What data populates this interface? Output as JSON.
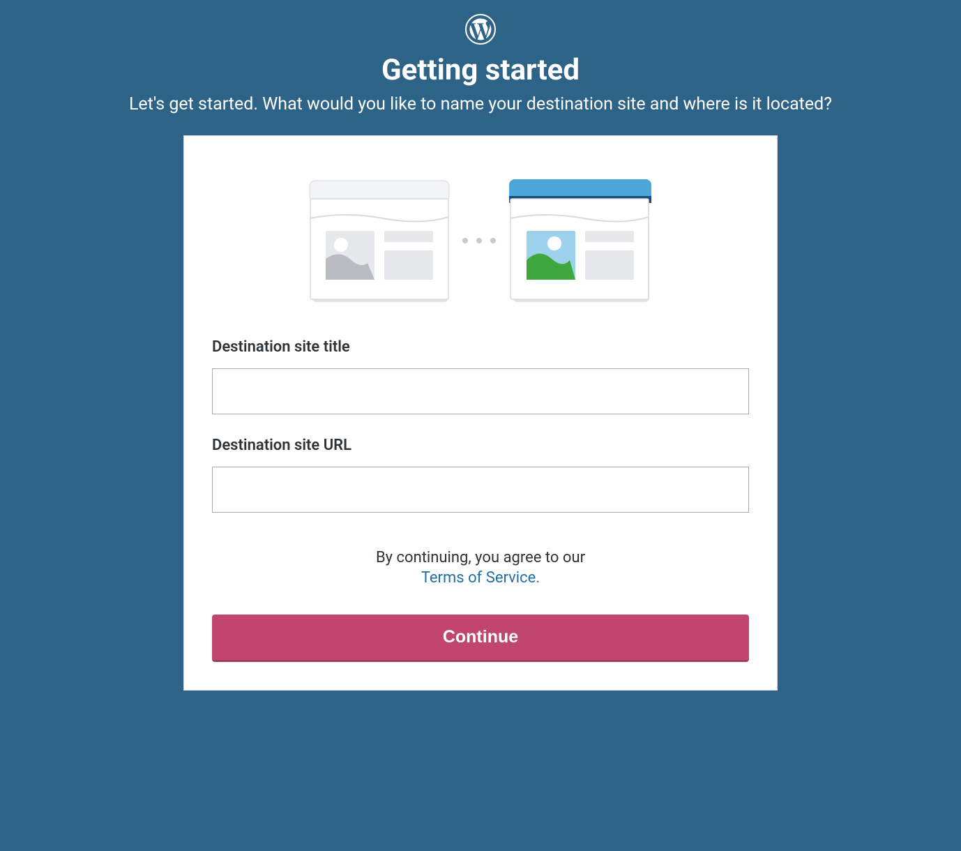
{
  "header": {
    "title": "Getting started",
    "subtitle": "Let's get started. What would you like to name your destination site and where is it located?"
  },
  "form": {
    "site_title_label": "Destination site title",
    "site_title_value": "",
    "site_url_label": "Destination site URL",
    "site_url_value": ""
  },
  "terms": {
    "prefix": "By continuing, you agree to our",
    "link_label": "Terms of Service."
  },
  "buttons": {
    "continue_label": "Continue"
  },
  "icons": {
    "logo": "wordpress-logo-icon"
  },
  "colors": {
    "background": "#2e6388",
    "card_bg": "#ffffff",
    "primary_button": "#c0466f",
    "link": "#1e6fa3",
    "text_dark": "#2c3338"
  }
}
